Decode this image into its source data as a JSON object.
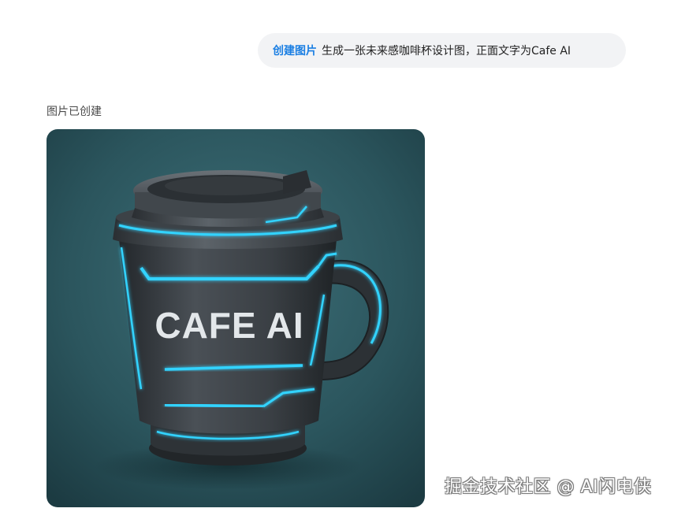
{
  "prompt": {
    "tag": "创建图片",
    "text": "生成一张未来感咖啡杯设计图，正面文字为Cafe AI"
  },
  "status": {
    "text": "图片已创建"
  },
  "generated_image": {
    "cup_text": "CAFE AI",
    "description_colors": {
      "background": "#2f5d64",
      "cup_body": "#3b4045",
      "glow": "#31d3ff"
    }
  },
  "watermark": {
    "text": "掘金技术社区 @ AI闪电侠"
  }
}
